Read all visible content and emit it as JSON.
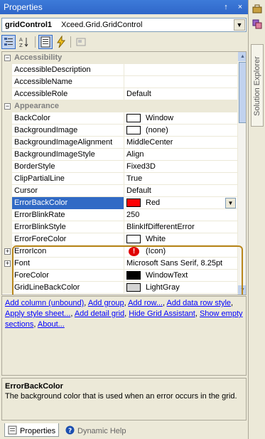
{
  "window": {
    "title": "Properties",
    "pin_glyph": "↑",
    "close_glyph": "×"
  },
  "dock": {
    "solution_explorer_label": "Solution Explorer"
  },
  "object_selector": {
    "name": "gridControl1",
    "type": "Xceed.Grid.GridControl"
  },
  "properties": [
    {
      "kind": "cat",
      "name": "Accessibility",
      "expander": "−"
    },
    {
      "kind": "prop",
      "name": "AccessibleDescription",
      "value": ""
    },
    {
      "kind": "prop",
      "name": "AccessibleName",
      "value": ""
    },
    {
      "kind": "prop",
      "name": "AccessibleRole",
      "value": "Default"
    },
    {
      "kind": "cat",
      "name": "Appearance",
      "expander": "−"
    },
    {
      "kind": "prop",
      "name": "BackColor",
      "value": "Window",
      "swatch": "#ffffff"
    },
    {
      "kind": "prop",
      "name": "BackgroundImage",
      "value": "(none)",
      "swatch": "#ffffff"
    },
    {
      "kind": "prop",
      "name": "BackgroundImageAlignment",
      "value": "MiddleCenter"
    },
    {
      "kind": "prop",
      "name": "BackgroundImageStyle",
      "value": "Align"
    },
    {
      "kind": "prop",
      "name": "BorderStyle",
      "value": "Fixed3D"
    },
    {
      "kind": "prop",
      "name": "ClipPartialLine",
      "value": "True"
    },
    {
      "kind": "prop",
      "name": "Cursor",
      "value": "Default"
    },
    {
      "kind": "prop",
      "name": "ErrorBackColor",
      "value": "Red",
      "swatch": "#ff0000",
      "selected": true
    },
    {
      "kind": "prop",
      "name": "ErrorBlinkRate",
      "value": "250"
    },
    {
      "kind": "prop",
      "name": "ErrorBlinkStyle",
      "value": "BlinkIfDifferentError"
    },
    {
      "kind": "prop",
      "name": "ErrorForeColor",
      "value": "White",
      "swatch": "#ffffff"
    },
    {
      "kind": "prop",
      "name": "ErrorIcon",
      "value": "(Icon)",
      "icon": "error-icon",
      "icon_glyph": "!",
      "expander": "+"
    },
    {
      "kind": "prop",
      "name": "Font",
      "value": "Microsoft Sans Serif, 8.25pt",
      "expander": "+"
    },
    {
      "kind": "prop",
      "name": "ForeColor",
      "value": "WindowText",
      "swatch": "#000000"
    },
    {
      "kind": "prop",
      "name": "GridLineBackColor",
      "value": "LightGray",
      "swatch": "#d3d3d3"
    }
  ],
  "commands": {
    "links": [
      "Add column (unbound)",
      "Add group",
      "Add row...",
      "Add data row style",
      "Apply style sheet...",
      "Add detail grid",
      "Hide Grid Assistant",
      "Show empty sections",
      "About..."
    ]
  },
  "description": {
    "title": "ErrorBackColor",
    "text": "The background color that is used when an error occurs in the grid."
  },
  "tabs": [
    {
      "label": "Properties"
    },
    {
      "label": "Dynamic Help"
    }
  ],
  "colors": {
    "titlebar": "#2f67c9",
    "selection": "#316ac5",
    "highlight_border": "#b8861b",
    "link": "#0000ff"
  }
}
